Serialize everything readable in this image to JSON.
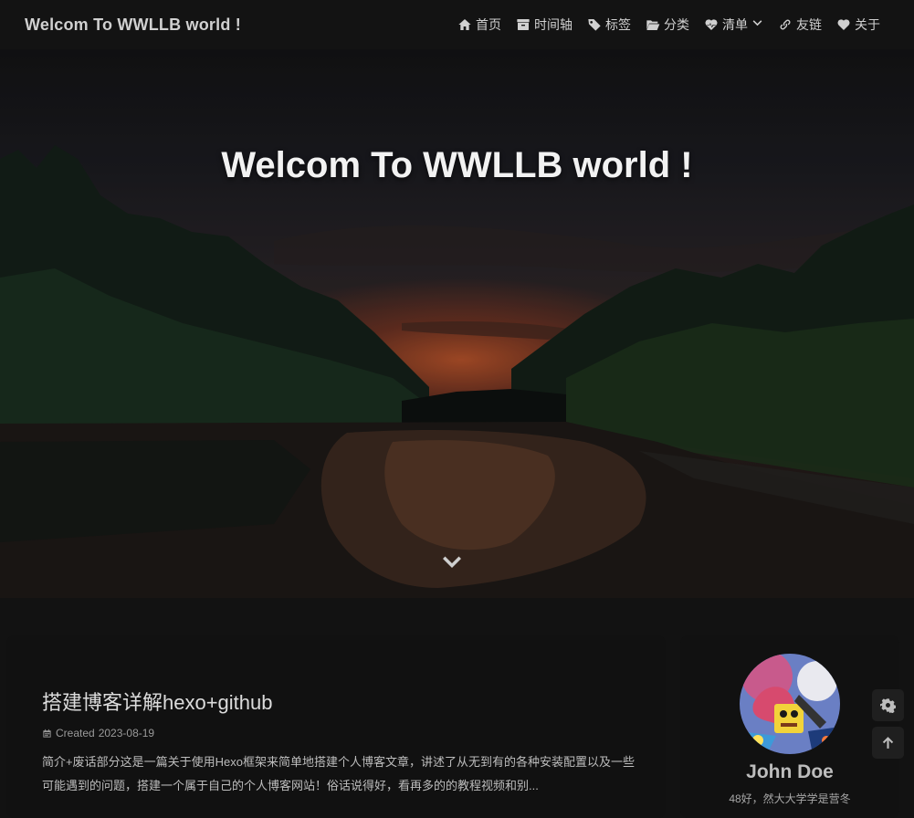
{
  "nav": {
    "site_name": "Welcom To WWLLB world !",
    "menus": [
      {
        "label": "首页",
        "icon": "home-icon"
      },
      {
        "label": "时间轴",
        "icon": "archive-icon"
      },
      {
        "label": "标签",
        "icon": "tags-icon"
      },
      {
        "label": "分类",
        "icon": "folder-open-icon"
      },
      {
        "label": "清单",
        "icon": "heartbeat-icon",
        "dropdown": true
      },
      {
        "label": "友链",
        "icon": "link-icon"
      },
      {
        "label": "关于",
        "icon": "heart-icon"
      }
    ]
  },
  "hero": {
    "title": "Welcom To WWLLB world !",
    "scroll_icon": "chevron-down-icon"
  },
  "post": {
    "title": "搭建博客详解hexo+github",
    "meta_label": "Created",
    "date": "2023-08-19",
    "excerpt": "简介+废话部分这是一篇关于使用Hexo框架来简单地搭建个人博客文章，讲述了从无到有的各种安装配置以及一些可能遇到的问题，搭建一个属于自己的个人博客网站！俗话说得好，看再多的的教程视频和别..."
  },
  "author": {
    "name": "John Doe",
    "description": "48好，然大大学学是营冬"
  },
  "rightside": {
    "settings_icon": "gear-icon",
    "top_icon": "arrow-up-icon"
  },
  "colors": {
    "background": "#121212",
    "card": "#111111",
    "nav": "#131313"
  }
}
